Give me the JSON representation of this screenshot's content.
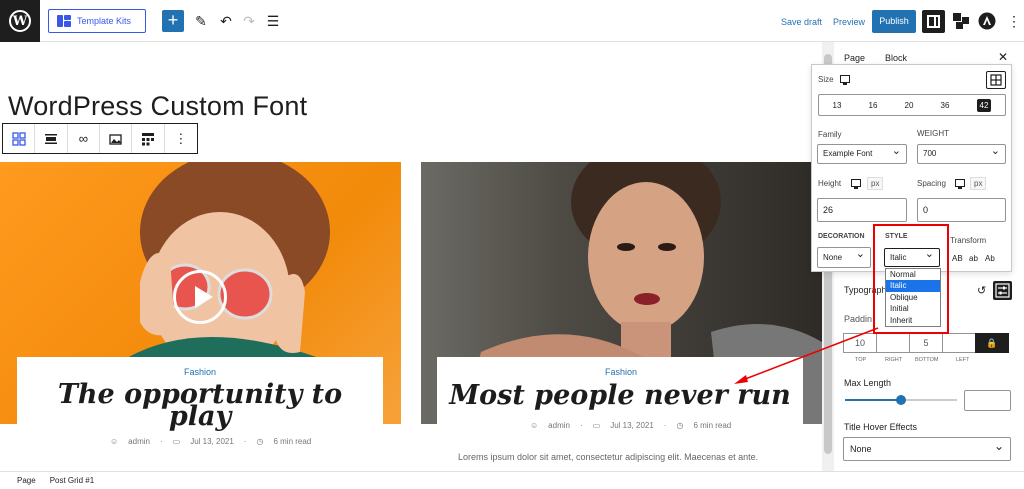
{
  "topbar": {
    "template_kits_label": "Template Kits",
    "add_label": "+",
    "save_draft_label": "Save draft",
    "preview_label": "Preview",
    "publish_label": "Publish"
  },
  "editor": {
    "post_title": "WordPress Custom Font",
    "cards": [
      {
        "category": "Fashion",
        "headline_line1": "The opportunity to",
        "headline_line2": "play",
        "author": "admin",
        "date": "Jul 13, 2021",
        "read_time": "6 min read"
      },
      {
        "category": "Fashion",
        "headline_line1": "Most people never run",
        "author": "admin",
        "date": "Jul 13, 2021",
        "read_time": "6 min read",
        "excerpt": "Lorems ipsum dolor sit amet, consectetur adipiscing elit. Maecenas et ante."
      }
    ]
  },
  "sidebar": {
    "tab_page": "Page",
    "tab_block": "Block",
    "typography_label": "Typograph",
    "padding_label": "Paddin",
    "padding_values": [
      "10",
      "",
      "5",
      ""
    ],
    "padding_sublabels": [
      "TOP",
      "RIGHT",
      "BOTTOM",
      "LEFT"
    ],
    "max_length_label": "Max Length",
    "max_length_value_pct": 50,
    "title_hover_label": "Title Hover Effects",
    "title_hover_value": "None"
  },
  "typography_popover": {
    "size_label": "Size",
    "sizes": [
      "13",
      "16",
      "20",
      "36",
      "42"
    ],
    "selected_size": "42",
    "family_label": "Family",
    "family_value": "Example Font",
    "weight_label": "WEIGHT",
    "weight_value": "700",
    "height_label": "Height",
    "height_unit": "px",
    "height_value": "26",
    "spacing_label": "Spacing",
    "spacing_unit": "px",
    "spacing_value": "0",
    "decoration_label": "DECORATION",
    "decoration_value": "None",
    "style_label": "STYLE",
    "style_value": "Italic",
    "transform_label": "Transform",
    "transform_options": [
      "AB",
      "ab",
      "Ab"
    ],
    "style_options": [
      "Normal",
      "Italic",
      "Oblique",
      "Initial",
      "Inherit"
    ],
    "style_selected_index": 1
  },
  "bottombar": {
    "crumb1": "Page",
    "crumb2": "Post Grid #1"
  },
  "colors": {
    "accent": "#2271b1",
    "highlight": "#e00000",
    "dark": "#1e1e1e"
  },
  "icons": [
    "wordpress-icon",
    "template-kits-icon",
    "pen-icon",
    "undo-icon",
    "redo-icon",
    "list-view-icon",
    "settings-icon",
    "play-icon",
    "lock-icon",
    "reset-icon"
  ]
}
